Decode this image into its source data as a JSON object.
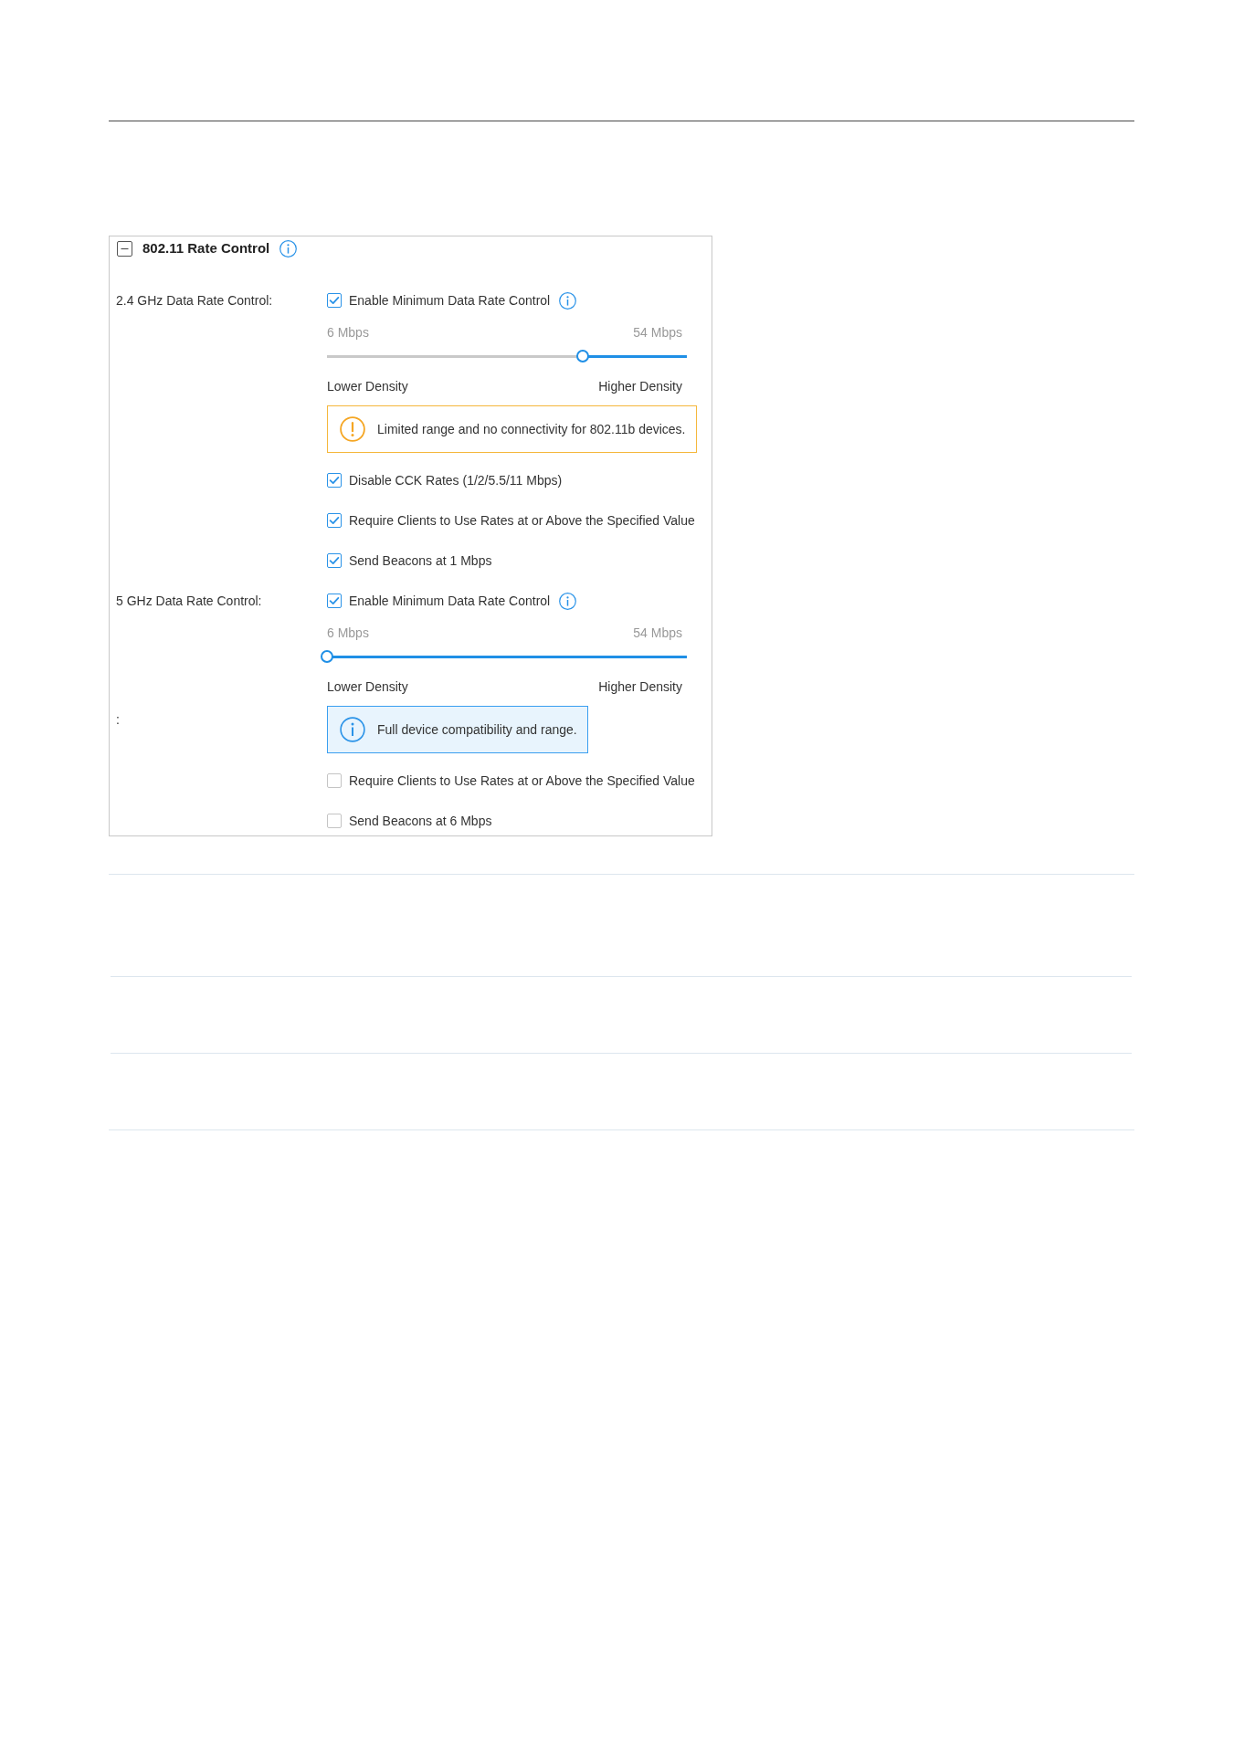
{
  "panel": {
    "title": "802.11 Rate Control",
    "expanded": true,
    "rows": [
      {
        "label": "2.4 GHz Data Rate Control:",
        "kind": "checkbox",
        "text": "Enable Minimum Data Rate Control",
        "checked": true,
        "has_info": true
      },
      {
        "kind": "slider",
        "min_label": "6 Mbps",
        "max_label": "54 Mbps",
        "level": 0.71,
        "low_label": "Lower Density",
        "high_label": "Higher Density"
      },
      {
        "kind": "warning",
        "text": "Limited range and no connectivity for 802.11b devices."
      },
      {
        "kind": "checkbox",
        "text": "Disable CCK Rates (1/2/5.5/11 Mbps)",
        "checked": true,
        "has_info": false
      },
      {
        "kind": "checkbox",
        "text": "Require Clients to Use Rates at or Above the Specified Value",
        "checked": true,
        "has_info": false
      },
      {
        "kind": "checkbox",
        "text": "Send Beacons at 1 Mbps",
        "checked": true,
        "has_info": false
      },
      {
        "label": "5 GHz Data Rate Control:",
        "kind": "checkbox",
        "text": "Enable Minimum Data Rate Control",
        "checked": true,
        "has_info": true
      },
      {
        "kind": "slider",
        "min_label": "6 Mbps",
        "max_label": "54 Mbps",
        "level": 0,
        "low_label": "Lower Density",
        "high_label": "Higher Density"
      },
      {
        "label": ":",
        "kind": "info",
        "text": "Full device compatibility and range."
      },
      {
        "kind": "checkbox",
        "text": "Require Clients to Use Rates at or Above the Specified Value",
        "checked": false,
        "has_info": false
      },
      {
        "kind": "checkbox",
        "text": "Send Beacons at 6 Mbps",
        "checked": false,
        "has_info": false
      }
    ]
  }
}
